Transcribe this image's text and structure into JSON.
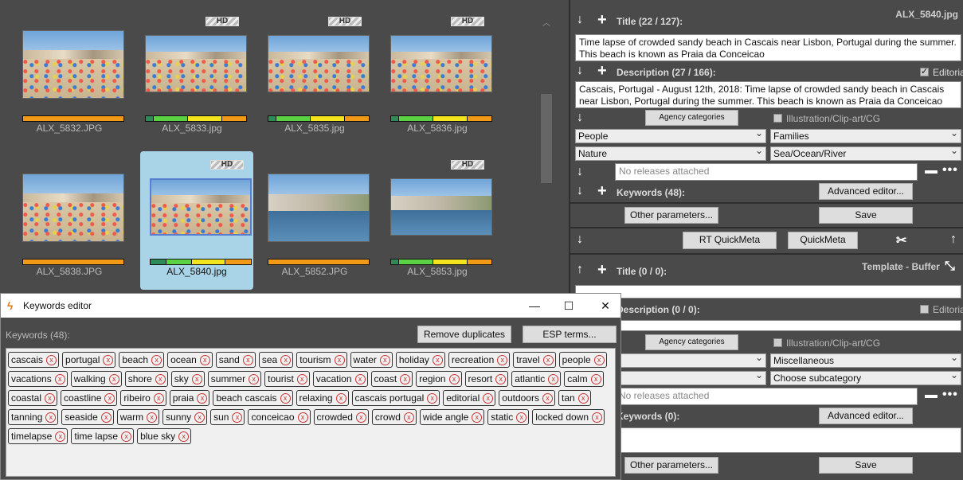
{
  "gallery": {
    "hd_label": "HD",
    "thumbs": [
      {
        "filename": "ALX_5832.JPG",
        "hd": false,
        "bar": [
          0,
          0,
          0,
          100
        ],
        "selected": false
      },
      {
        "filename": "ALX_5833.jpg",
        "hd": true,
        "bar": [
          8,
          34,
          34,
          24
        ],
        "selected": false
      },
      {
        "filename": "ALX_5835.jpg",
        "hd": true,
        "bar": [
          8,
          34,
          34,
          24
        ],
        "selected": false
      },
      {
        "filename": "ALX_5836.jpg",
        "hd": true,
        "bar": [
          8,
          34,
          34,
          24
        ],
        "selected": false
      },
      {
        "filename": "ALX_5838.JPG",
        "hd": false,
        "bar": [
          0,
          0,
          0,
          100
        ],
        "selected": false
      },
      {
        "filename": "ALX_5840.jpg",
        "hd": true,
        "bar": [
          16,
          25,
          34,
          25
        ],
        "selected": true
      },
      {
        "filename": "ALX_5852.JPG",
        "hd": false,
        "bar": [
          0,
          0,
          0,
          100
        ],
        "selected": false
      },
      {
        "filename": "ALX_5853.jpg",
        "hd": true,
        "bar": [
          8,
          34,
          34,
          24
        ],
        "selected": false
      }
    ]
  },
  "colors": {
    "bar_dark_green": "#2e8b57",
    "bar_green": "#5bd243",
    "bar_yellow": "#f2e41d",
    "bar_orange": "#f29a18",
    "panel_bg": "#4a4a4a",
    "selection": "#a9d3e6"
  },
  "meta": {
    "filename": "ALX_5840.jpg",
    "title_label": "Title (22 / 127):",
    "title_value": "Time lapse of crowded sandy beach in Cascais near Lisbon, Portugal during the summer. This beach is known as Praia da Conceicao",
    "editorial_label": "Editorial",
    "description_label": "Description (27 / 166):",
    "description_value": "Cascais, Portugal - August 12th, 2018: Time lapse of crowded sandy beach in Cascais near Lisbon, Portugal during the summer. This beach is known as Praia da Conceicao",
    "agency_categories": "Agency categories",
    "illustration_label": "Illustration/Clip-art/CG",
    "cat1": "People",
    "cat2": "Families",
    "cat3": "Nature",
    "cat4": "Sea/Ocean/River",
    "releases_placeholder": "No releases attached",
    "keywords_label": "Keywords (48):",
    "advanced_editor": "Advanced editor...",
    "other_parameters": "Other parameters...",
    "save": "Save",
    "rt_quickmeta": "RT QuickMeta",
    "quickmeta": "QuickMeta"
  },
  "template": {
    "heading": "Template - Buffer",
    "title_label": "Title (0 / 0):",
    "description_label": "Description (0 / 0):",
    "editorial_label": "Editorial",
    "agency_categories": "Agency categories",
    "illustration_label": "Illustration/Clip-art/CG",
    "cat2": "Miscellaneous",
    "cat4": "Choose subcategory",
    "releases_placeholder": "No releases attached",
    "keywords_label": "Keywords (0):",
    "advanced_editor": "Advanced editor...",
    "other_parameters": "Other parameters...",
    "save": "Save"
  },
  "keywords_editor": {
    "window_title": "Keywords editor",
    "header_label": "Keywords (48):",
    "remove_duplicates": "Remove duplicates",
    "esp_terms": "ESP terms...",
    "remove_glyph": "x",
    "keywords": [
      "cascais",
      "portugal",
      "beach",
      "ocean",
      "sand",
      "sea",
      "tourism",
      "water",
      "holiday",
      "recreation",
      "travel",
      "people",
      "vacations",
      "walking",
      "shore",
      "sky",
      "summer",
      "tourist",
      "vacation",
      "coast",
      "region",
      "resort",
      "atlantic",
      "calm",
      "coastal",
      "coastline",
      "ribeiro",
      "praia",
      "beach cascais",
      "relaxing",
      "cascais portugal",
      "editorial",
      "outdoors",
      "tan",
      "tanning",
      "seaside",
      "warm",
      "sunny",
      "sun",
      "conceicao",
      "crowded",
      "crowd",
      "wide angle",
      "static",
      "locked down",
      "timelapse",
      "time lapse",
      "blue sky"
    ]
  }
}
